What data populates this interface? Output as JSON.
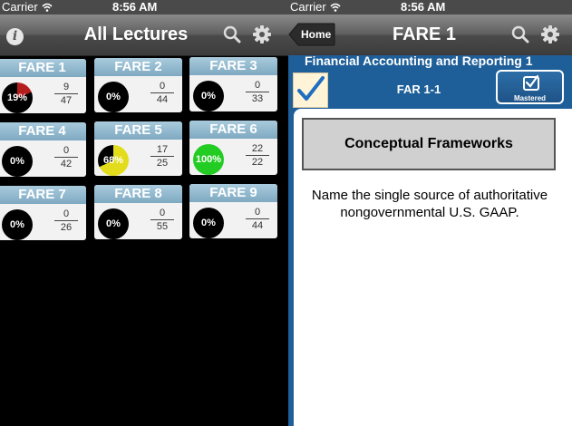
{
  "left": {
    "status": {
      "carrier": "Carrier",
      "time": "8:56 AM"
    },
    "nav": {
      "title": "All Lectures"
    },
    "tiles": [
      {
        "label": "FARE 1",
        "percent": "19%",
        "progress": 0.19,
        "pie_color": "#b51d1d",
        "label_color": "#ffffff",
        "answered": "9",
        "total": "47"
      },
      {
        "label": "FARE 2",
        "percent": "0%",
        "progress": 0,
        "pie_color": "#000000",
        "label_color": "#ffffff",
        "answered": "0",
        "total": "44"
      },
      {
        "label": "FARE 3",
        "percent": "0%",
        "progress": 0,
        "pie_color": "#000000",
        "label_color": "#ffffff",
        "answered": "0",
        "total": "33"
      },
      {
        "label": "FARE 4",
        "percent": "0%",
        "progress": 0,
        "pie_color": "#000000",
        "label_color": "#ffffff",
        "answered": "0",
        "total": "42"
      },
      {
        "label": "FARE 5",
        "percent": "68%",
        "progress": 0.68,
        "pie_color": "#e3dc1c",
        "label_color": "#ffffff",
        "answered": "17",
        "total": "25"
      },
      {
        "label": "FARE 6",
        "percent": "100%",
        "progress": 1,
        "pie_color": "#22cc22",
        "label_color": "#ffffff",
        "answered": "22",
        "total": "22"
      },
      {
        "label": "FARE 7",
        "percent": "0%",
        "progress": 0,
        "pie_color": "#000000",
        "label_color": "#ffffff",
        "answered": "0",
        "total": "26"
      },
      {
        "label": "FARE 8",
        "percent": "0%",
        "progress": 0,
        "pie_color": "#000000",
        "label_color": "#ffffff",
        "answered": "0",
        "total": "55"
      },
      {
        "label": "FARE 9",
        "percent": "0%",
        "progress": 0,
        "pie_color": "#000000",
        "label_color": "#ffffff",
        "answered": "0",
        "total": "44"
      }
    ]
  },
  "right": {
    "status": {
      "carrier": "Carrier",
      "time": "8:56 AM"
    },
    "nav": {
      "home_label": "Home",
      "title": "FARE 1"
    },
    "course_title": "Financial Accounting and Reporting 1",
    "card_id": "FAR 1-1",
    "mastered_label": "Mastered",
    "topic": "Conceptual Frameworks",
    "question": "Name the single source of authoritative nongovernmental U.S. GAAP."
  },
  "colors": {
    "accent_blue": "#1f5f99",
    "tile_header": "#8fb6cc",
    "check_mark": "#1f6fc0"
  }
}
